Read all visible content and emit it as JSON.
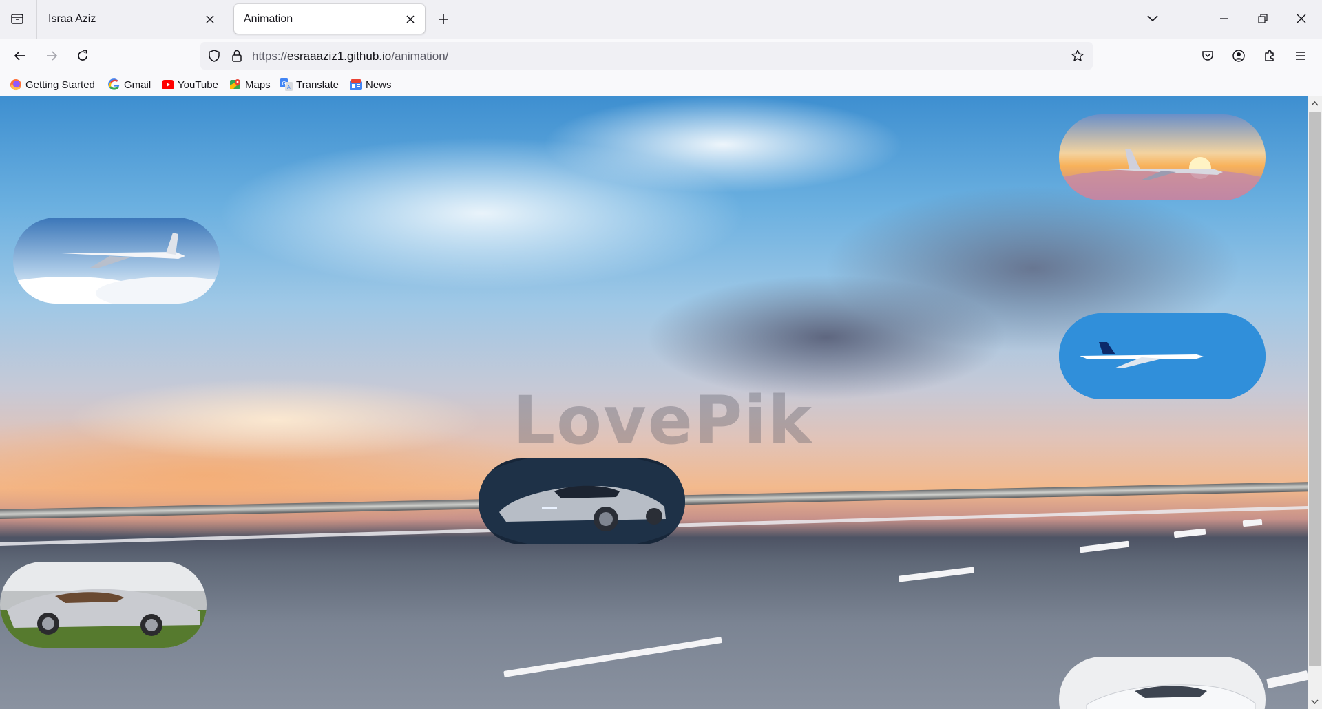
{
  "tabs": [
    {
      "title": "Israa Aziz",
      "active": false
    },
    {
      "title": "Animation",
      "active": true
    }
  ],
  "navbar": {
    "url_scheme": "https://",
    "url_host": "esraaaziz1.github.io",
    "url_path": "/animation/"
  },
  "bookmarks": [
    {
      "label": "Getting Started",
      "icon": "firefox-icon"
    },
    {
      "label": "Gmail",
      "icon": "google-icon"
    },
    {
      "label": "YouTube",
      "icon": "youtube-icon"
    },
    {
      "label": "Maps",
      "icon": "maps-icon"
    },
    {
      "label": "Translate",
      "icon": "translate-icon"
    },
    {
      "label": "News",
      "icon": "news-icon"
    }
  ],
  "page": {
    "watermark": "LovePik",
    "images": [
      {
        "name": "airplane-sunset-image",
        "alt": "Airplane flying above clouds at sunset"
      },
      {
        "name": "airplane-clouds-image",
        "alt": "Airplane flying above white clouds"
      },
      {
        "name": "egyptair-plane-image",
        "alt": "EgyptAir airplane in blue sky"
      },
      {
        "name": "sports-car-image",
        "alt": "Silver concept sports car"
      },
      {
        "name": "convertible-car-image",
        "alt": "Silver convertible supercar on grass"
      },
      {
        "name": "white-car-image",
        "alt": "White sports car"
      }
    ]
  },
  "colors": {
    "accent": "#0060df",
    "tab_strip": "#f0f0f4",
    "toolbar": "#f9f9fb"
  }
}
